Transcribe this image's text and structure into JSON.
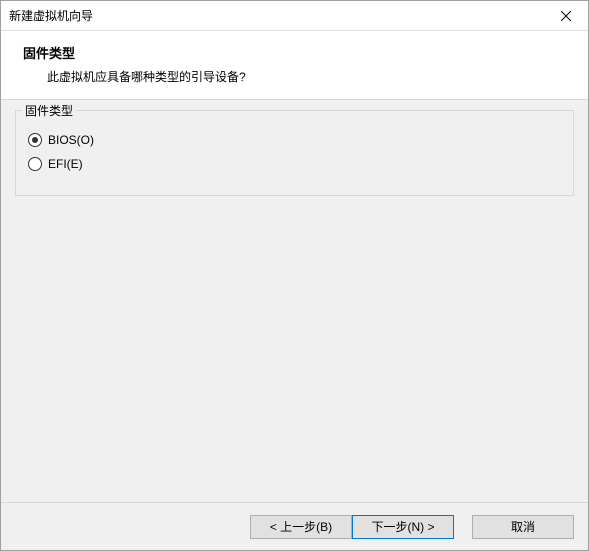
{
  "titlebar": {
    "title": "新建虚拟机向导"
  },
  "header": {
    "title": "固件类型",
    "subtitle": "此虚拟机应具备哪种类型的引导设备?"
  },
  "group": {
    "title": "固件类型",
    "options": [
      {
        "label": "BIOS(O)",
        "checked": true
      },
      {
        "label": "EFI(E)",
        "checked": false
      }
    ]
  },
  "footer": {
    "back": "< 上一步(B)",
    "next": "下一步(N) >",
    "cancel": "取消"
  }
}
